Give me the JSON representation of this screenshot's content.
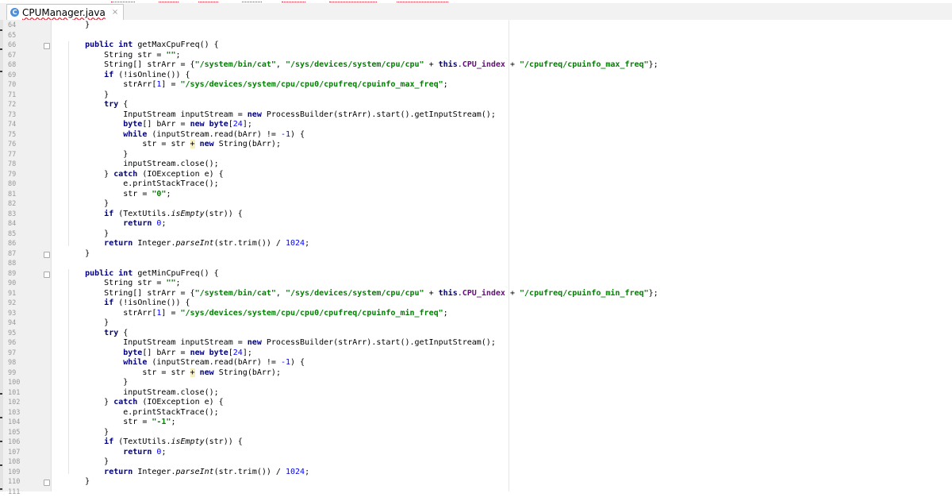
{
  "tab": {
    "title": "CPUManager.java",
    "icon": "java-class-icon",
    "close": "×"
  },
  "lines": [
    {
      "n": "64",
      "tokens": [
        [
          "t",
          "    "
        ],
        [
          "t",
          "}"
        ]
      ]
    },
    {
      "n": "65",
      "tokens": []
    },
    {
      "n": "66",
      "tokens": [
        [
          "t",
          "    "
        ],
        [
          "kw",
          "public"
        ],
        [
          "t",
          " "
        ],
        [
          "kw",
          "int"
        ],
        [
          "t",
          " getMaxCpuFreq() {"
        ]
      ]
    },
    {
      "n": "67",
      "tokens": [
        [
          "t",
          "        String str = "
        ],
        [
          "str",
          "\"\""
        ],
        [
          "t",
          ";"
        ]
      ]
    },
    {
      "n": "68",
      "tokens": [
        [
          "t",
          "        String[] strArr = {"
        ],
        [
          "str",
          "\"/system/bin/cat\""
        ],
        [
          "t",
          ", "
        ],
        [
          "str",
          "\"/sys/devices/system/cpu/cpu\""
        ],
        [
          "t",
          " + "
        ],
        [
          "kw",
          "this"
        ],
        [
          "t",
          "."
        ],
        [
          "fld",
          "CPU_index"
        ],
        [
          "t",
          " + "
        ],
        [
          "str",
          "\"/cpufreq/cpuinfo_max_freq\""
        ],
        [
          "t",
          "};"
        ]
      ]
    },
    {
      "n": "69",
      "tokens": [
        [
          "t",
          "        "
        ],
        [
          "kw",
          "if"
        ],
        [
          "t",
          " (!isOnline()) {"
        ]
      ]
    },
    {
      "n": "70",
      "tokens": [
        [
          "t",
          "            strArr["
        ],
        [
          "num",
          "1"
        ],
        [
          "t",
          "] = "
        ],
        [
          "str",
          "\"/sys/devices/system/cpu/cpu0/cpufreq/cpuinfo_max_freq\""
        ],
        [
          "t",
          ";"
        ]
      ]
    },
    {
      "n": "71",
      "tokens": [
        [
          "t",
          "        }"
        ]
      ]
    },
    {
      "n": "72",
      "tokens": [
        [
          "t",
          "        "
        ],
        [
          "kw",
          "try"
        ],
        [
          "t",
          " {"
        ]
      ]
    },
    {
      "n": "73",
      "tokens": [
        [
          "t",
          "            InputStream inputStream = "
        ],
        [
          "kw",
          "new"
        ],
        [
          "t",
          " ProcessBuilder(strArr).start().getInputStream();"
        ]
      ]
    },
    {
      "n": "74",
      "tokens": [
        [
          "t",
          "            "
        ],
        [
          "kw",
          "byte"
        ],
        [
          "t",
          "[] bArr = "
        ],
        [
          "kw",
          "new"
        ],
        [
          "t",
          " "
        ],
        [
          "kw",
          "byte"
        ],
        [
          "t",
          "["
        ],
        [
          "num",
          "24"
        ],
        [
          "t",
          "];"
        ]
      ]
    },
    {
      "n": "75",
      "tokens": [
        [
          "t",
          "            "
        ],
        [
          "kw",
          "while"
        ],
        [
          "t",
          " (inputStream.read(bArr) != "
        ],
        [
          "num",
          "-1"
        ],
        [
          "t",
          ") {"
        ]
      ]
    },
    {
      "n": "76",
      "tokens": [
        [
          "t",
          "                str = str "
        ],
        [
          "plus",
          "+"
        ],
        [
          "t",
          " "
        ],
        [
          "kw",
          "new"
        ],
        [
          "t",
          " String(bArr);"
        ]
      ]
    },
    {
      "n": "77",
      "tokens": [
        [
          "t",
          "            }"
        ]
      ]
    },
    {
      "n": "78",
      "tokens": [
        [
          "t",
          "            inputStream.close();"
        ]
      ]
    },
    {
      "n": "79",
      "tokens": [
        [
          "t",
          "        } "
        ],
        [
          "kw",
          "catch"
        ],
        [
          "t",
          " (IOException e) {"
        ]
      ]
    },
    {
      "n": "80",
      "tokens": [
        [
          "t",
          "            e.printStackTrace();"
        ]
      ]
    },
    {
      "n": "81",
      "tokens": [
        [
          "t",
          "            str = "
        ],
        [
          "str",
          "\"0\""
        ],
        [
          "t",
          ";"
        ]
      ]
    },
    {
      "n": "82",
      "tokens": [
        [
          "t",
          "        }"
        ]
      ]
    },
    {
      "n": "83",
      "tokens": [
        [
          "t",
          "        "
        ],
        [
          "kw",
          "if"
        ],
        [
          "t",
          " (TextUtils."
        ],
        [
          "st",
          "isEmpty"
        ],
        [
          "t",
          "(str)) {"
        ]
      ]
    },
    {
      "n": "84",
      "tokens": [
        [
          "t",
          "            "
        ],
        [
          "kw",
          "return"
        ],
        [
          "t",
          " "
        ],
        [
          "num",
          "0"
        ],
        [
          "t",
          ";"
        ]
      ]
    },
    {
      "n": "85",
      "tokens": [
        [
          "t",
          "        }"
        ]
      ]
    },
    {
      "n": "86",
      "tokens": [
        [
          "t",
          "        "
        ],
        [
          "kw",
          "return"
        ],
        [
          "t",
          " Integer."
        ],
        [
          "st",
          "parseInt"
        ],
        [
          "t",
          "(str.trim()) / "
        ],
        [
          "num",
          "1024"
        ],
        [
          "t",
          ";"
        ]
      ]
    },
    {
      "n": "87",
      "tokens": [
        [
          "t",
          "    }"
        ]
      ]
    },
    {
      "n": "88",
      "tokens": []
    },
    {
      "n": "89",
      "tokens": [
        [
          "t",
          "    "
        ],
        [
          "kw",
          "public"
        ],
        [
          "t",
          " "
        ],
        [
          "kw",
          "int"
        ],
        [
          "t",
          " getMinCpuFreq() {"
        ]
      ]
    },
    {
      "n": "90",
      "tokens": [
        [
          "t",
          "        String str = "
        ],
        [
          "str",
          "\"\""
        ],
        [
          "t",
          ";"
        ]
      ]
    },
    {
      "n": "91",
      "tokens": [
        [
          "t",
          "        String[] strArr = {"
        ],
        [
          "str",
          "\"/system/bin/cat\""
        ],
        [
          "t",
          ", "
        ],
        [
          "str",
          "\"/sys/devices/system/cpu/cpu\""
        ],
        [
          "t",
          " + "
        ],
        [
          "kw",
          "this"
        ],
        [
          "t",
          "."
        ],
        [
          "fld",
          "CPU_index"
        ],
        [
          "t",
          " + "
        ],
        [
          "str",
          "\"/cpufreq/cpuinfo_min_freq\""
        ],
        [
          "t",
          "};"
        ]
      ]
    },
    {
      "n": "92",
      "tokens": [
        [
          "t",
          "        "
        ],
        [
          "kw",
          "if"
        ],
        [
          "t",
          " (!isOnline()) {"
        ]
      ]
    },
    {
      "n": "93",
      "tokens": [
        [
          "t",
          "            strArr["
        ],
        [
          "num",
          "1"
        ],
        [
          "t",
          "] = "
        ],
        [
          "str",
          "\"/sys/devices/system/cpu/cpu0/cpufreq/cpuinfo_min_freq\""
        ],
        [
          "t",
          ";"
        ]
      ]
    },
    {
      "n": "94",
      "tokens": [
        [
          "t",
          "        }"
        ]
      ]
    },
    {
      "n": "95",
      "tokens": [
        [
          "t",
          "        "
        ],
        [
          "kw",
          "try"
        ],
        [
          "t",
          " {"
        ]
      ]
    },
    {
      "n": "96",
      "tokens": [
        [
          "t",
          "            InputStream inputStream = "
        ],
        [
          "kw",
          "new"
        ],
        [
          "t",
          " ProcessBuilder(strArr).start().getInputStream();"
        ]
      ]
    },
    {
      "n": "97",
      "tokens": [
        [
          "t",
          "            "
        ],
        [
          "kw",
          "byte"
        ],
        [
          "t",
          "[] bArr = "
        ],
        [
          "kw",
          "new"
        ],
        [
          "t",
          " "
        ],
        [
          "kw",
          "byte"
        ],
        [
          "t",
          "["
        ],
        [
          "num",
          "24"
        ],
        [
          "t",
          "];"
        ]
      ]
    },
    {
      "n": "98",
      "tokens": [
        [
          "t",
          "            "
        ],
        [
          "kw",
          "while"
        ],
        [
          "t",
          " (inputStream.read(bArr) != "
        ],
        [
          "num",
          "-1"
        ],
        [
          "t",
          ") {"
        ]
      ]
    },
    {
      "n": "99",
      "tokens": [
        [
          "t",
          "                str = str "
        ],
        [
          "plus",
          "+"
        ],
        [
          "t",
          " "
        ],
        [
          "kw",
          "new"
        ],
        [
          "t",
          " String(bArr);"
        ]
      ]
    },
    {
      "n": "100",
      "tokens": [
        [
          "t",
          "            }"
        ]
      ]
    },
    {
      "n": "101",
      "tokens": [
        [
          "t",
          "            inputStream.close();"
        ]
      ]
    },
    {
      "n": "102",
      "tokens": [
        [
          "t",
          "        } "
        ],
        [
          "kw",
          "catch"
        ],
        [
          "t",
          " (IOException e) {"
        ]
      ]
    },
    {
      "n": "103",
      "tokens": [
        [
          "t",
          "            e.printStackTrace();"
        ]
      ]
    },
    {
      "n": "104",
      "tokens": [
        [
          "t",
          "            str = "
        ],
        [
          "str",
          "\"-1\""
        ],
        [
          "t",
          ";"
        ]
      ]
    },
    {
      "n": "105",
      "tokens": [
        [
          "t",
          "        }"
        ]
      ]
    },
    {
      "n": "106",
      "tokens": [
        [
          "t",
          "        "
        ],
        [
          "kw",
          "if"
        ],
        [
          "t",
          " (TextUtils."
        ],
        [
          "st",
          "isEmpty"
        ],
        [
          "t",
          "(str)) {"
        ]
      ]
    },
    {
      "n": "107",
      "tokens": [
        [
          "t",
          "            "
        ],
        [
          "kw",
          "return"
        ],
        [
          "t",
          " "
        ],
        [
          "num",
          "0"
        ],
        [
          "t",
          ";"
        ]
      ]
    },
    {
      "n": "108",
      "tokens": [
        [
          "t",
          "        }"
        ]
      ]
    },
    {
      "n": "109",
      "tokens": [
        [
          "t",
          "        "
        ],
        [
          "kw",
          "return"
        ],
        [
          "t",
          " Integer."
        ],
        [
          "st",
          "parseInt"
        ],
        [
          "t",
          "(str.trim()) / "
        ],
        [
          "num",
          "1024"
        ],
        [
          "t",
          ";"
        ]
      ]
    },
    {
      "n": "110",
      "tokens": [
        [
          "t",
          "    }"
        ]
      ]
    },
    {
      "n": "111",
      "tokens": []
    }
  ],
  "folds": [
    "66",
    "87",
    "89",
    "110"
  ]
}
